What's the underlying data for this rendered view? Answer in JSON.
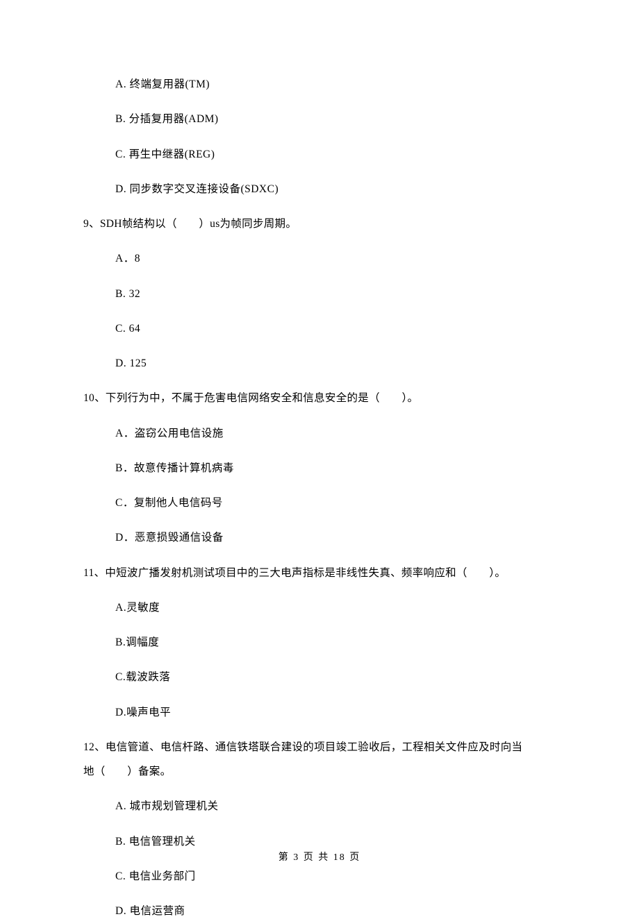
{
  "q8_options": {
    "a": "A. 终端复用器(TM)",
    "b": "B. 分插复用器(ADM)",
    "c": "C. 再生中继器(REG)",
    "d": "D. 同步数字交叉连接设备(SDXC)"
  },
  "q9": {
    "stem": "9、SDH帧结构以（　　）us为帧同步周期。",
    "options": {
      "a": "A．8",
      "b": "B. 32",
      "c": "C. 64",
      "d": "D. 125"
    }
  },
  "q10": {
    "stem": "10、下列行为中，不属于危害电信网络安全和信息安全的是（　　）。",
    "options": {
      "a": "A．盗窃公用电信设施",
      "b": "B．故意传播计算机病毒",
      "c": "C．复制他人电信码号",
      "d": "D．恶意损毁通信设备"
    }
  },
  "q11": {
    "stem": "11、中短波广播发射机测试项目中的三大电声指标是非线性失真、频率响应和（　　）。",
    "options": {
      "a": "A.灵敏度",
      "b": "B.调幅度",
      "c": "C.载波跌落",
      "d": "D.噪声电平"
    }
  },
  "q12": {
    "stem_line1": "12、电信管道、电信杆路、通信铁塔联合建设的项目竣工验收后，工程相关文件应及时向当",
    "stem_line2": "地（　　）备案。",
    "options": {
      "a": "A. 城市规划管理机关",
      "b": "B. 电信管理机关",
      "c": "C. 电信业务部门",
      "d": "D. 电信运营商"
    }
  },
  "footer": "第 3 页 共 18 页"
}
